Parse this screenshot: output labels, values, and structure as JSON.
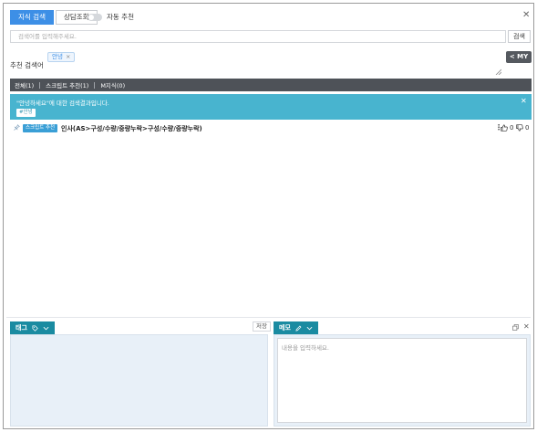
{
  "tabs": [
    {
      "label": "지식 검색",
      "active": true
    },
    {
      "label": "상담조회",
      "active": false
    }
  ],
  "auto_recommend": {
    "label": "자동 추천",
    "enabled": false
  },
  "search": {
    "placeholder": "검색어를 입력해주세요.",
    "value": "",
    "button_label": "검색"
  },
  "recommend": {
    "label": "추천 검색어",
    "keyword": "안녕"
  },
  "my_button": "< MY",
  "filters": [
    {
      "label": "전체(1)"
    },
    {
      "label": "스크립트 추천(1)"
    },
    {
      "label": "M지식(0)"
    }
  ],
  "banner": {
    "text": "\"안녕하세요\"에 대한 검색결과입니다.",
    "tag": "#안녕"
  },
  "result": {
    "badge": "스크립트 추천",
    "title": "인사(AS>구성/수량/중량누락>구성/수량/중량누락)",
    "likes": "0",
    "dislikes": "0"
  },
  "tag_panel": {
    "title": "태그",
    "save_label": "저장"
  },
  "memo_panel": {
    "title": "메모",
    "placeholder": "내용을 입력하세요."
  },
  "colors": {
    "accent": "#3d8fe6",
    "banner": "#48b4cf",
    "panel_head": "#1a8ba1",
    "filter_bar": "#4e5258"
  }
}
